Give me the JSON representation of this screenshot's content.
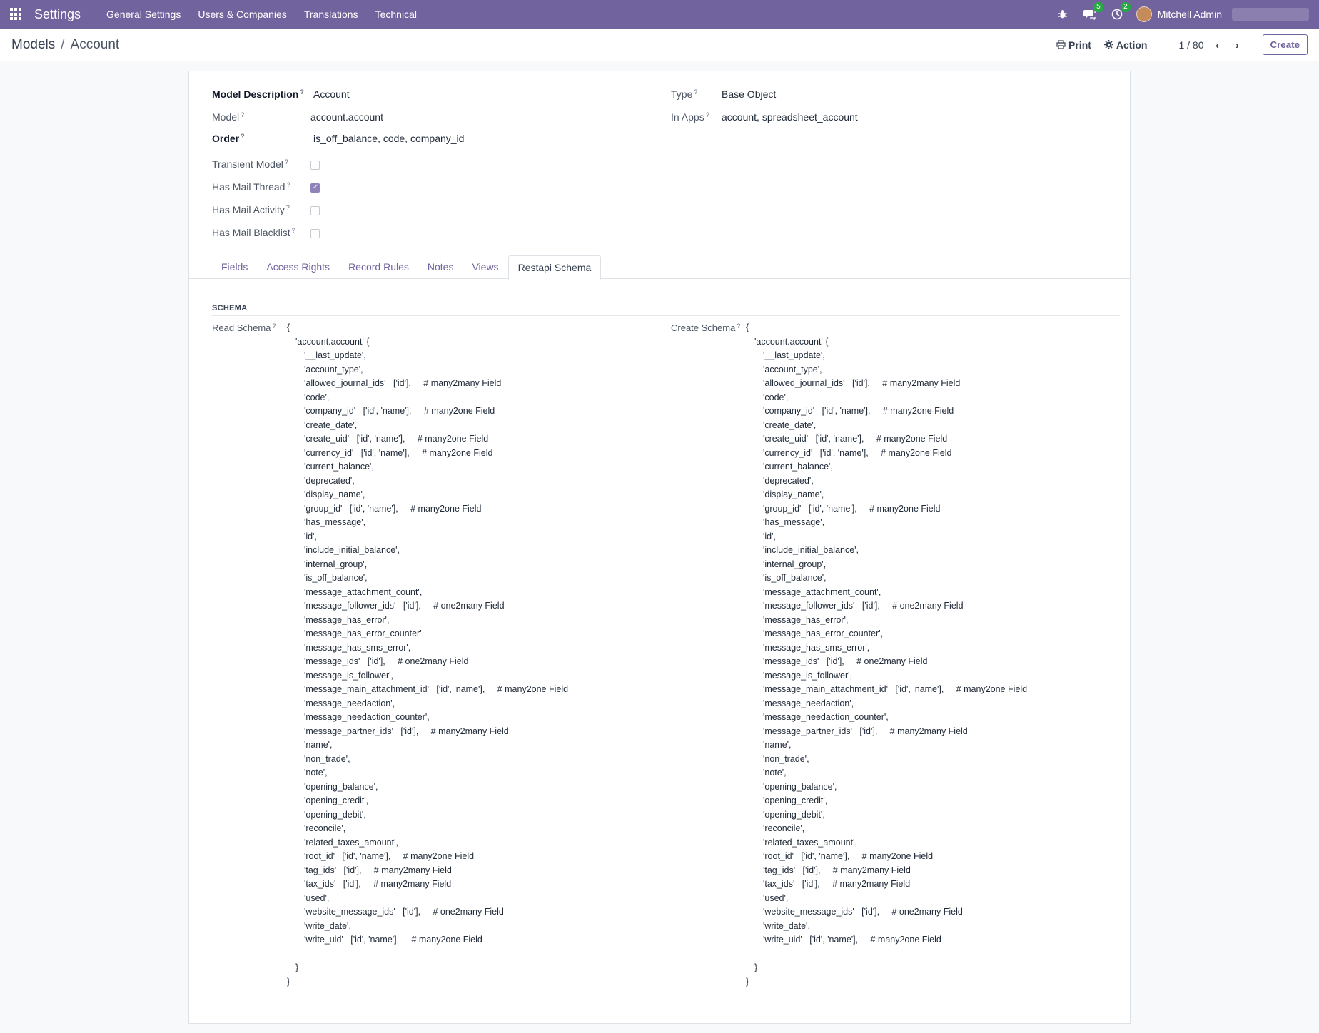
{
  "navbar": {
    "app_title": "Settings",
    "menu": [
      "General Settings",
      "Users & Companies",
      "Translations",
      "Technical"
    ],
    "messages_badge": "5",
    "activities_badge": "2",
    "user_name": "Mitchell Admin"
  },
  "breadcrumb": {
    "parent": "Models",
    "separator": "/",
    "current": "Account"
  },
  "control": {
    "print_label": "Print",
    "action_label": "Action",
    "pager": "1 / 80",
    "create_label": "Create"
  },
  "form": {
    "model_description_label": "Model Description",
    "model_description": "Account",
    "model_label": "Model",
    "model": "account.account",
    "order_label": "Order",
    "order": "is_off_balance, code, company_id",
    "transient_label": "Transient Model",
    "mail_thread_label": "Has Mail Thread",
    "mail_activity_label": "Has Mail Activity",
    "mail_blacklist_label": "Has Mail Blacklist",
    "type_label": "Type",
    "type": "Base Object",
    "in_apps_label": "In Apps",
    "in_apps": "account, spreadsheet_account",
    "help_mark": "?",
    "checkboxes": {
      "transient": false,
      "mail_thread": true,
      "mail_activity": false,
      "mail_blacklist": false
    }
  },
  "tabs": [
    "Fields",
    "Access Rights",
    "Record Rules",
    "Notes",
    "Views",
    "Restapi Schema"
  ],
  "active_tab": "Restapi Schema",
  "schema": {
    "section_title": "SCHEMA",
    "read_label": "Read Schema",
    "create_label": "Create Schema",
    "open_brace": "{",
    "model_line": "'account.account' {",
    "close_inner": "}",
    "close_outer": "}",
    "lines": [
      "'__last_update',",
      "'account_type',",
      "'allowed_journal_ids'   ['id'],     # many2many Field",
      "'code',",
      "'company_id'   ['id', 'name'],     # many2one Field",
      "'create_date',",
      "'create_uid'   ['id', 'name'],     # many2one Field",
      "'currency_id'   ['id', 'name'],     # many2one Field",
      "'current_balance',",
      "'deprecated',",
      "'display_name',",
      "'group_id'   ['id', 'name'],     # many2one Field",
      "'has_message',",
      "'id',",
      "'include_initial_balance',",
      "'internal_group',",
      "'is_off_balance',",
      "'message_attachment_count',",
      "'message_follower_ids'   ['id'],     # one2many Field",
      "'message_has_error',",
      "'message_has_error_counter',",
      "'message_has_sms_error',",
      "'message_ids'   ['id'],     # one2many Field",
      "'message_is_follower',",
      "'message_main_attachment_id'   ['id', 'name'],     # many2one Field",
      "'message_needaction',",
      "'message_needaction_counter',",
      "'message_partner_ids'   ['id'],     # many2many Field",
      "'name',",
      "'non_trade',",
      "'note',",
      "'opening_balance',",
      "'opening_credit',",
      "'opening_debit',",
      "'reconcile',",
      "'related_taxes_amount',",
      "'root_id'   ['id', 'name'],     # many2one Field",
      "'tag_ids'   ['id'],     # many2many Field",
      "'tax_ids'   ['id'],     # many2many Field",
      "'used',",
      "'website_message_ids'   ['id'],     # one2many Field",
      "'write_date',",
      "'write_uid'   ['id', 'name'],     # many2one Field"
    ]
  }
}
